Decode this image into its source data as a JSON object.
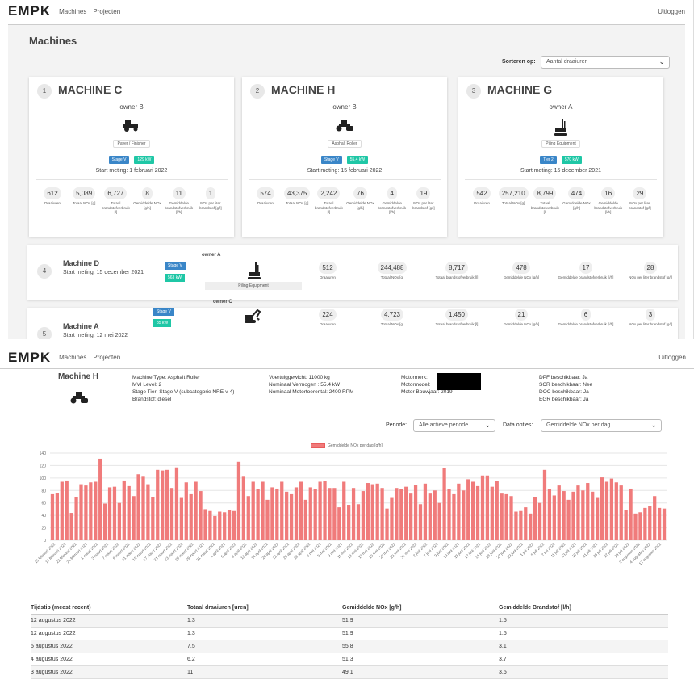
{
  "nav": {
    "brand": "EMPK",
    "links": [
      "Machines",
      "Projecten"
    ],
    "logout": "Uitloggen"
  },
  "overview": {
    "title": "Machines",
    "sort_label": "Sorteren op:",
    "sort_value": "Aantal draaiuren",
    "stat_labels": [
      "Draaiuren",
      "Totaal NOx [g]",
      "Totaal brandstofverbruik [l]",
      "Gemiddelde NOx [g/h]",
      "Gemiddelde brandstofverbruik [l/h]",
      "NOx per liter brandstof [g/l]"
    ],
    "cards": [
      {
        "rank": "1",
        "name": "MACHINE C",
        "owner": "owner B",
        "type": "Paver / Finisher",
        "icon": "paver-icon",
        "stage": "Stage V",
        "power": "129 kW",
        "start": "Start meting: 1 februari 2022",
        "stats": [
          "612",
          "5,089",
          "6,727",
          "8",
          "11",
          "1"
        ]
      },
      {
        "rank": "2",
        "name": "MACHINE H",
        "owner": "owner B",
        "type": "Asphalt Roller",
        "icon": "roller-icon",
        "stage": "Stage V",
        "power": "55.4 kW",
        "start": "Start meting: 15 februari 2022",
        "stats": [
          "574",
          "43,375",
          "2,242",
          "76",
          "4",
          "19"
        ]
      },
      {
        "rank": "3",
        "name": "MACHINE G",
        "owner": "owner A",
        "type": "Piling Equipment",
        "icon": "piling-rig-icon",
        "stage": "Tier 2",
        "power": "570 kW",
        "start": "Start meting: 15 december 2021",
        "stats": [
          "542",
          "257,210",
          "8,799",
          "474",
          "16",
          "29"
        ]
      }
    ],
    "rows": [
      {
        "rank": "4",
        "name": "Machine D",
        "start": "Start meting: 15 december 2021",
        "stage": "Stage V",
        "power": "563 kW",
        "owner": "owner A",
        "type": "Piling Equipment",
        "stats": [
          "512",
          "244,488",
          "8,717",
          "478",
          "17",
          "28"
        ]
      },
      {
        "rank": "5",
        "name": "Machine A",
        "start": "Start meting: 12 mei 2022",
        "stage": "Stage V",
        "power": "85 kW",
        "owner": "owner C",
        "type": "",
        "stats": [
          "224",
          "4,723",
          "1,450",
          "21",
          "6",
          "3"
        ]
      }
    ],
    "row_labels": [
      "Draaiuren",
      "Totaal NOx [g]",
      "Totaal brandstofverbruik [l]",
      "Gemiddelde NOx [g/h]",
      "Gemiddelde brandstofverbruik [l/h]",
      "NOx per liter brandstof [g/l]"
    ]
  },
  "detail": {
    "name": "Machine H",
    "col1": [
      "Machine Type: Asphalt Roller",
      "MVI Level: 2",
      "Stage Tier: Stage V (subcategorie NRE-v-4)",
      "Brandstof: diesel"
    ],
    "col2": [
      "Voertuiggewicht: 11000 kg",
      "Nominaal Vermogen : 55.4 kW",
      "Nominaal Motortoerental: 2400 RPM"
    ],
    "col3": [
      "Motormerk:",
      "Motormodel:",
      "Motor Bouwjaar: 2019"
    ],
    "col4": [
      "DPF beschikbaar: Ja",
      "SCR beschikbaar: Nee",
      "DOC beschikbaar: Ja",
      "EGR beschikbaar: Ja"
    ],
    "periode_label": "Periode:",
    "periode_value": "Alle actieve periode",
    "data_label": "Data opties:",
    "data_value": "Gemiddelde NOx per dag",
    "table": {
      "headers": [
        "Tijdstip (meest recent)",
        "Totaal draaiuren [uren]",
        "Gemiddelde NOx [g/h]",
        "Gemiddelde Brandstof [l/h]"
      ],
      "rows": [
        [
          "12 augustus 2022",
          "1.3",
          "51.9",
          "1.5"
        ],
        [
          "12 augustus 2022",
          "1.3",
          "51.9",
          "1.5"
        ],
        [
          "5 augustus 2022",
          "7.5",
          "55.8",
          "3.1"
        ],
        [
          "4 augustus 2022",
          "6.2",
          "51.3",
          "3.7"
        ],
        [
          "3 augustus 2022",
          "11",
          "49.1",
          "3.5"
        ]
      ]
    }
  },
  "chart_data": {
    "type": "bar",
    "legend": "Gemiddelde NOx per dag [g/h]",
    "ylim": [
      0,
      140
    ],
    "yticks": [
      0,
      20,
      40,
      60,
      80,
      100,
      120,
      140
    ],
    "grid": true,
    "color": "#f07b7b",
    "xticklabels": [
      "15 februari 2022",
      "17 februari 2022",
      "22 februari 2022",
      "24 februari 2022",
      "1 maart 2022",
      "3 maart 2022",
      "7 maart 2022",
      "9 maart 2022",
      "11 maart 2022",
      "15 maart 2022",
      "17 maart 2022",
      "21 maart 2022",
      "23 maart 2022",
      "25 maart 2022",
      "29 maart 2022",
      "31 maart 2022",
      "4 april 2022",
      "6 april 2022",
      "8 april 2022",
      "12 april 2022",
      "14 april 2022",
      "20 april 2022",
      "22 april 2022",
      "26 april 2022",
      "28 april 2022",
      "3 mei 2022",
      "5 mei 2022",
      "9 mei 2022",
      "11 mei 2022",
      "13 mei 2022",
      "17 mei 2022",
      "19 mei 2022",
      "23 mei 2022",
      "25 mei 2022",
      "31 mei 2022",
      "2 juni 2022",
      "7 juni 2022",
      "9 juni 2022",
      "13 juni 2022",
      "15 juni 2022",
      "17 juni 2022",
      "21 juni 2022",
      "23 juni 2022",
      "27 juni 2022",
      "29 juni 2022",
      "1 juli 2022",
      "5 juli 2022",
      "7 juli 2022",
      "11 juli 2022",
      "13 juli 2022",
      "19 juli 2022",
      "21 juli 2022",
      "25 juli 2022",
      "27 juli 2022",
      "29 juli 2022",
      "2 augustus 2022",
      "4 augustus 2022",
      "12 augustus 2022"
    ],
    "values": [
      74,
      76,
      94,
      96,
      44,
      70,
      90,
      88,
      93,
      94,
      131,
      59,
      85,
      86,
      60,
      96,
      87,
      71,
      106,
      102,
      90,
      70,
      113,
      112,
      113,
      84,
      117,
      68,
      93,
      74,
      94,
      79,
      50,
      47,
      39,
      46,
      45,
      48,
      47,
      126,
      102,
      71,
      94,
      82,
      94,
      65,
      85,
      83,
      94,
      78,
      74,
      85,
      94,
      65,
      85,
      82,
      94,
      95,
      84,
      84,
      53,
      94,
      57,
      84,
      58,
      79,
      92,
      90,
      91,
      84,
      51,
      68,
      84,
      82,
      86,
      75,
      89,
      58,
      91,
      75,
      80,
      60,
      116,
      82,
      74,
      91,
      80,
      98,
      94,
      87,
      104,
      104,
      86,
      95,
      75,
      74,
      71,
      46,
      47,
      53,
      43,
      70,
      60,
      113,
      82,
      72,
      88,
      79,
      65,
      78,
      88,
      80,
      92,
      78,
      68,
      101,
      94,
      99,
      93,
      88,
      49,
      83,
      43,
      45,
      52,
      55,
      71,
      52,
      51
    ]
  }
}
